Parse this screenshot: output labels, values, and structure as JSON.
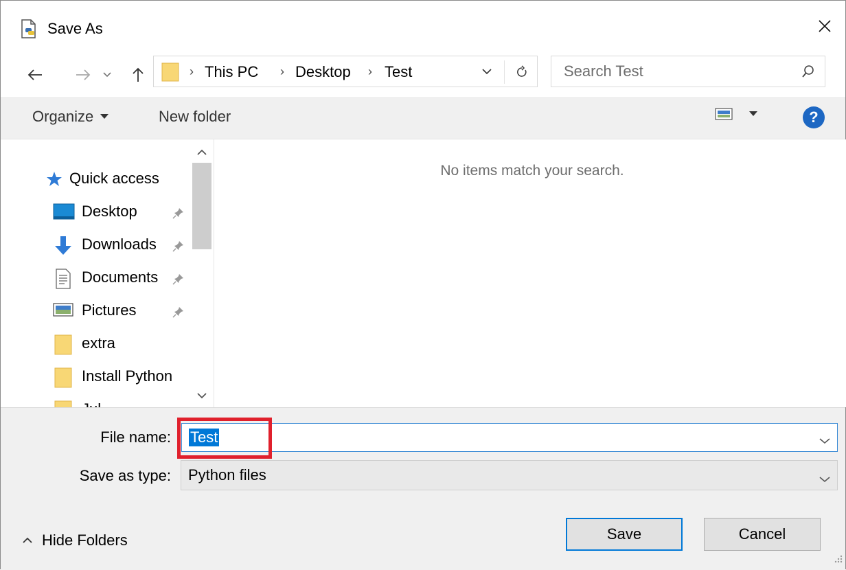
{
  "window": {
    "title": "Save As",
    "close_label": "✕"
  },
  "address": {
    "crumbs": [
      "This PC",
      "Desktop",
      "Test"
    ],
    "search_placeholder": "Search Test"
  },
  "commands": {
    "organize": "Organize",
    "new_folder": "New folder",
    "help": "?"
  },
  "nav": {
    "items": [
      {
        "label": "Quick access",
        "icon": "star-icon",
        "pinned": false
      },
      {
        "label": "Desktop",
        "icon": "desktop-icon",
        "pinned": true
      },
      {
        "label": "Downloads",
        "icon": "download-arrow-icon",
        "pinned": true
      },
      {
        "label": "Documents",
        "icon": "document-icon",
        "pinned": true
      },
      {
        "label": "Pictures",
        "icon": "picture-icon",
        "pinned": true
      },
      {
        "label": "extra",
        "icon": "folder-icon",
        "pinned": false
      },
      {
        "label": "Install Python",
        "icon": "folder-icon",
        "pinned": false
      },
      {
        "label": "Jul",
        "icon": "folder-icon",
        "pinned": false
      }
    ]
  },
  "content": {
    "empty_message": "No items match your search."
  },
  "form": {
    "file_name_label": "File name:",
    "file_name_value": "Test",
    "save_as_type_label": "Save as type:",
    "save_as_type_value": "Python files"
  },
  "footer": {
    "hide_folders": "Hide Folders",
    "save": "Save",
    "cancel": "Cancel"
  },
  "colors": {
    "accent": "#0078d7",
    "highlight_box": "#e0202c",
    "help": "#1d67c3"
  }
}
